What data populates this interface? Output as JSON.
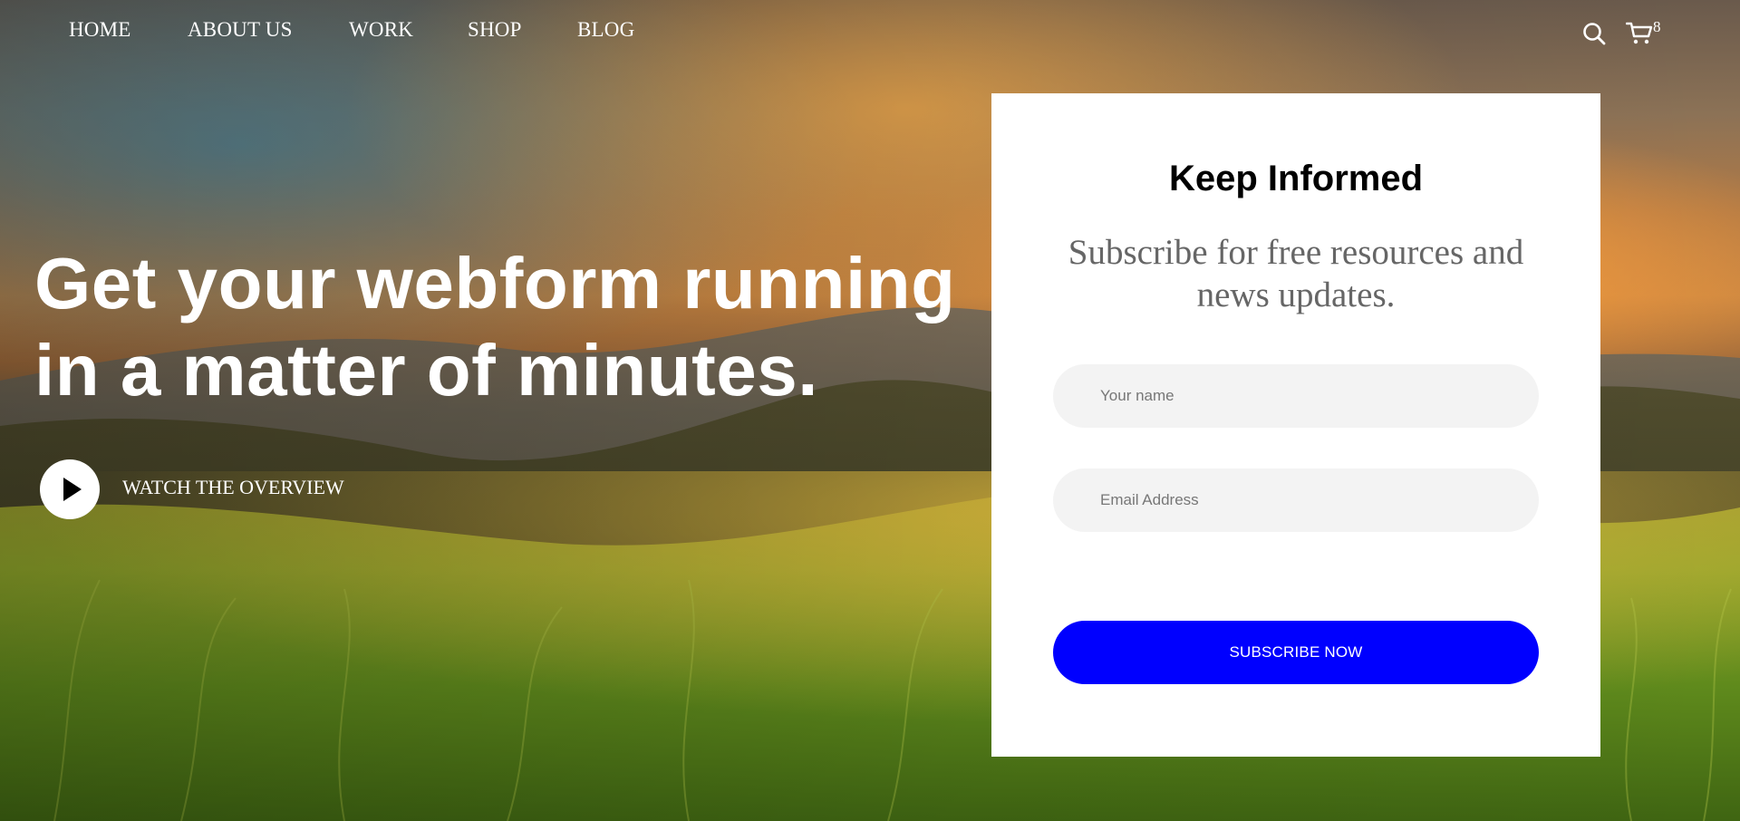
{
  "nav": {
    "items": [
      {
        "label": "HOME"
      },
      {
        "label": "ABOUT US"
      },
      {
        "label": "WORK"
      },
      {
        "label": "SHOP"
      },
      {
        "label": "BLOG"
      }
    ],
    "search_icon": "search-icon",
    "cart_icon": "cart-icon",
    "cart_count": "8"
  },
  "hero": {
    "headline": "Get your webform running in a matter of minutes.",
    "play_icon": "play-icon",
    "watch_label": "WATCH THE OVERVIEW"
  },
  "form": {
    "title": "Keep Informed",
    "subtitle": "Subscribe for free resources and news updates.",
    "name_placeholder": "Your name",
    "email_placeholder": "Email Address",
    "submit_label": "SUBSCRIBE NOW"
  },
  "colors": {
    "accent": "#0000ff",
    "card_background": "#ffffff",
    "field_background": "#f3f3f3",
    "subtitle_text": "#666666",
    "nav_text": "#ffffff"
  }
}
